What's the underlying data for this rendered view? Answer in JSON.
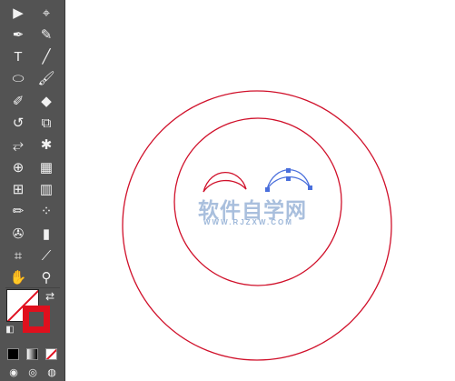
{
  "toolbar": {
    "tools": [
      {
        "name": "selection-tool-icon",
        "glyph": "▶"
      },
      {
        "name": "direct-selection-tool-icon",
        "glyph": "⌖"
      },
      {
        "name": "pen-tool-icon",
        "glyph": "✒"
      },
      {
        "name": "curvature-tool-icon",
        "glyph": "✎"
      },
      {
        "name": "type-tool-icon",
        "glyph": "T"
      },
      {
        "name": "line-segment-tool-icon",
        "glyph": "╱"
      },
      {
        "name": "ellipse-tool-icon",
        "glyph": "⬭"
      },
      {
        "name": "paintbrush-tool-icon",
        "glyph": "🖌"
      },
      {
        "name": "shaper-tool-icon",
        "glyph": "✐"
      },
      {
        "name": "eraser-tool-icon",
        "glyph": "◆"
      },
      {
        "name": "rotate-tool-icon",
        "glyph": "↺"
      },
      {
        "name": "scale-tool-icon",
        "glyph": "⧉"
      },
      {
        "name": "width-tool-icon",
        "glyph": "⥂"
      },
      {
        "name": "puppet-warp-tool-icon",
        "glyph": "✱"
      },
      {
        "name": "shape-builder-tool-icon",
        "glyph": "⊕"
      },
      {
        "name": "perspective-grid-tool-icon",
        "glyph": "▦"
      },
      {
        "name": "mesh-tool-icon",
        "glyph": "⊞"
      },
      {
        "name": "gradient-tool-icon",
        "glyph": "▥"
      },
      {
        "name": "eyedropper-tool-icon",
        "glyph": "✏"
      },
      {
        "name": "blend-tool-icon",
        "glyph": "⁘"
      },
      {
        "name": "symbol-sprayer-tool-icon",
        "glyph": "✇"
      },
      {
        "name": "column-graph-tool-icon",
        "glyph": "▮"
      },
      {
        "name": "artboard-tool-icon",
        "glyph": "⌗"
      },
      {
        "name": "slice-tool-icon",
        "glyph": "⟋"
      },
      {
        "name": "hand-tool-icon",
        "glyph": "✋"
      },
      {
        "name": "zoom-tool-icon",
        "glyph": "⚲"
      }
    ],
    "colors": {
      "fill": "none",
      "stroke": "#e0101d",
      "default": "#000000"
    }
  },
  "canvas": {
    "stroke_color": "#d0102a",
    "selection_color": "#4a6fdc",
    "watermark": "软件自学网",
    "watermark_sub": "WWW.RJZXW.COM"
  }
}
